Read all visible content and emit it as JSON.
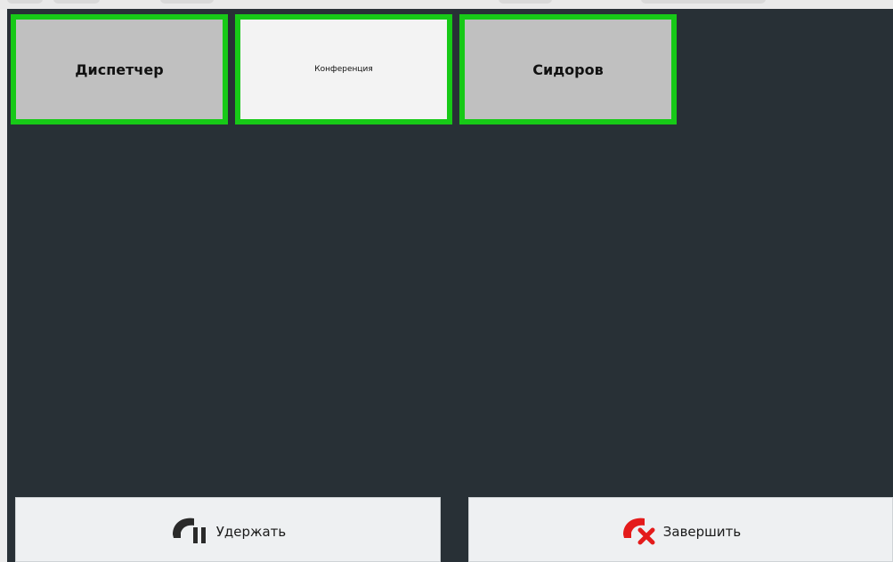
{
  "contacts": [
    {
      "label": "Диспетчер",
      "active": false
    },
    {
      "label": "Конференция",
      "active": true
    },
    {
      "label": "Сидоров",
      "active": false
    }
  ],
  "actions": {
    "hold_label": "Удержать",
    "end_label": "Завершить"
  },
  "icons": {
    "hold": "phone-hold-icon",
    "end": "phone-hangup-icon"
  },
  "colors": {
    "panel_background": "#283036",
    "tile_border_active": "#17c917",
    "tile_background": "#c0c0c0",
    "tile_background_selected": "#f3f3f3",
    "hold_icon": "#2a2a2a",
    "end_icon": "#e41b1b"
  }
}
